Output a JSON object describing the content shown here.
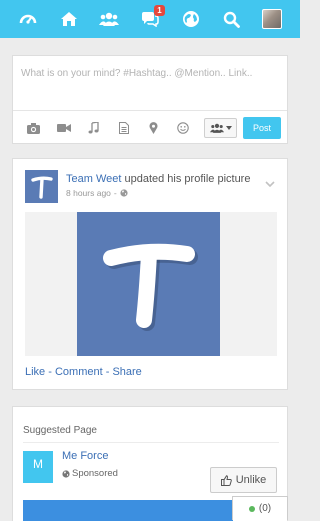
{
  "nav": {
    "items": [
      {
        "name": "dashboard-icon"
      },
      {
        "name": "home-icon"
      },
      {
        "name": "users-icon"
      },
      {
        "name": "messages-icon",
        "badge": "1"
      },
      {
        "name": "globe-icon"
      },
      {
        "name": "search-icon"
      },
      {
        "name": "user-avatar"
      }
    ],
    "color": "#42c6ef"
  },
  "composer": {
    "placeholder": "What is on your mind? #Hashtag.. @Mention.. Link..",
    "tools": [
      "camera-icon",
      "video-icon",
      "music-icon",
      "file-icon",
      "location-icon",
      "smile-icon"
    ],
    "privacy_icon": "users-icon",
    "post_label": "Post"
  },
  "story": {
    "avatar_letter": "T",
    "author": "Team Weet",
    "action": " updated his profile picture",
    "time": "8 hours ago",
    "actions": {
      "like": "Like",
      "sep1": " - ",
      "comment": "Comment",
      "sep2": " - ",
      "share": "Share"
    }
  },
  "suggested": {
    "title": "Suggested Page",
    "page_name": "Me Force",
    "sponsored": "Sponsored",
    "unlike_label": "Unlike",
    "logo_letter": "M"
  },
  "chat": {
    "count": "(0)"
  },
  "colors": {
    "accent": "#42c6ef",
    "link": "#3b6fb5",
    "brand_tile": "#5a7bb5",
    "online": "#5bb85d",
    "badge": "#e5483c"
  }
}
